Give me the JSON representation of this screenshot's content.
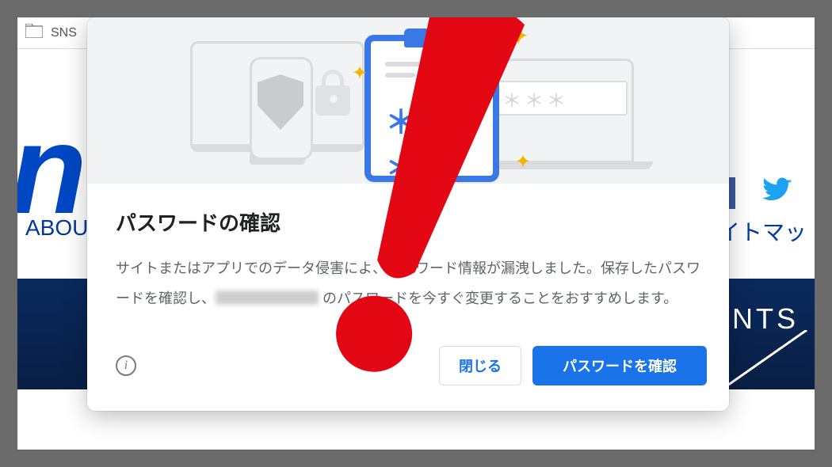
{
  "bookmark": {
    "label": "SNS"
  },
  "background": {
    "nav_left": "ABOUT",
    "nav_right": "イトマッ",
    "band_right": "ENTS"
  },
  "dialog": {
    "title": "パスワードの確認",
    "desc_part1": "サイトまたはアプリでのデータ侵害によ",
    "desc_part2": "、パスワード情報が漏洩しました。保存したパスワードを確認し、",
    "desc_part3": " のパスワードを今すぐ変更することをおすすめします。",
    "close_label": "閉じる",
    "confirm_label": "パスワードを確認",
    "password_mask": "＊＊＊＊",
    "clipboard_mask": "＊＊＊"
  }
}
